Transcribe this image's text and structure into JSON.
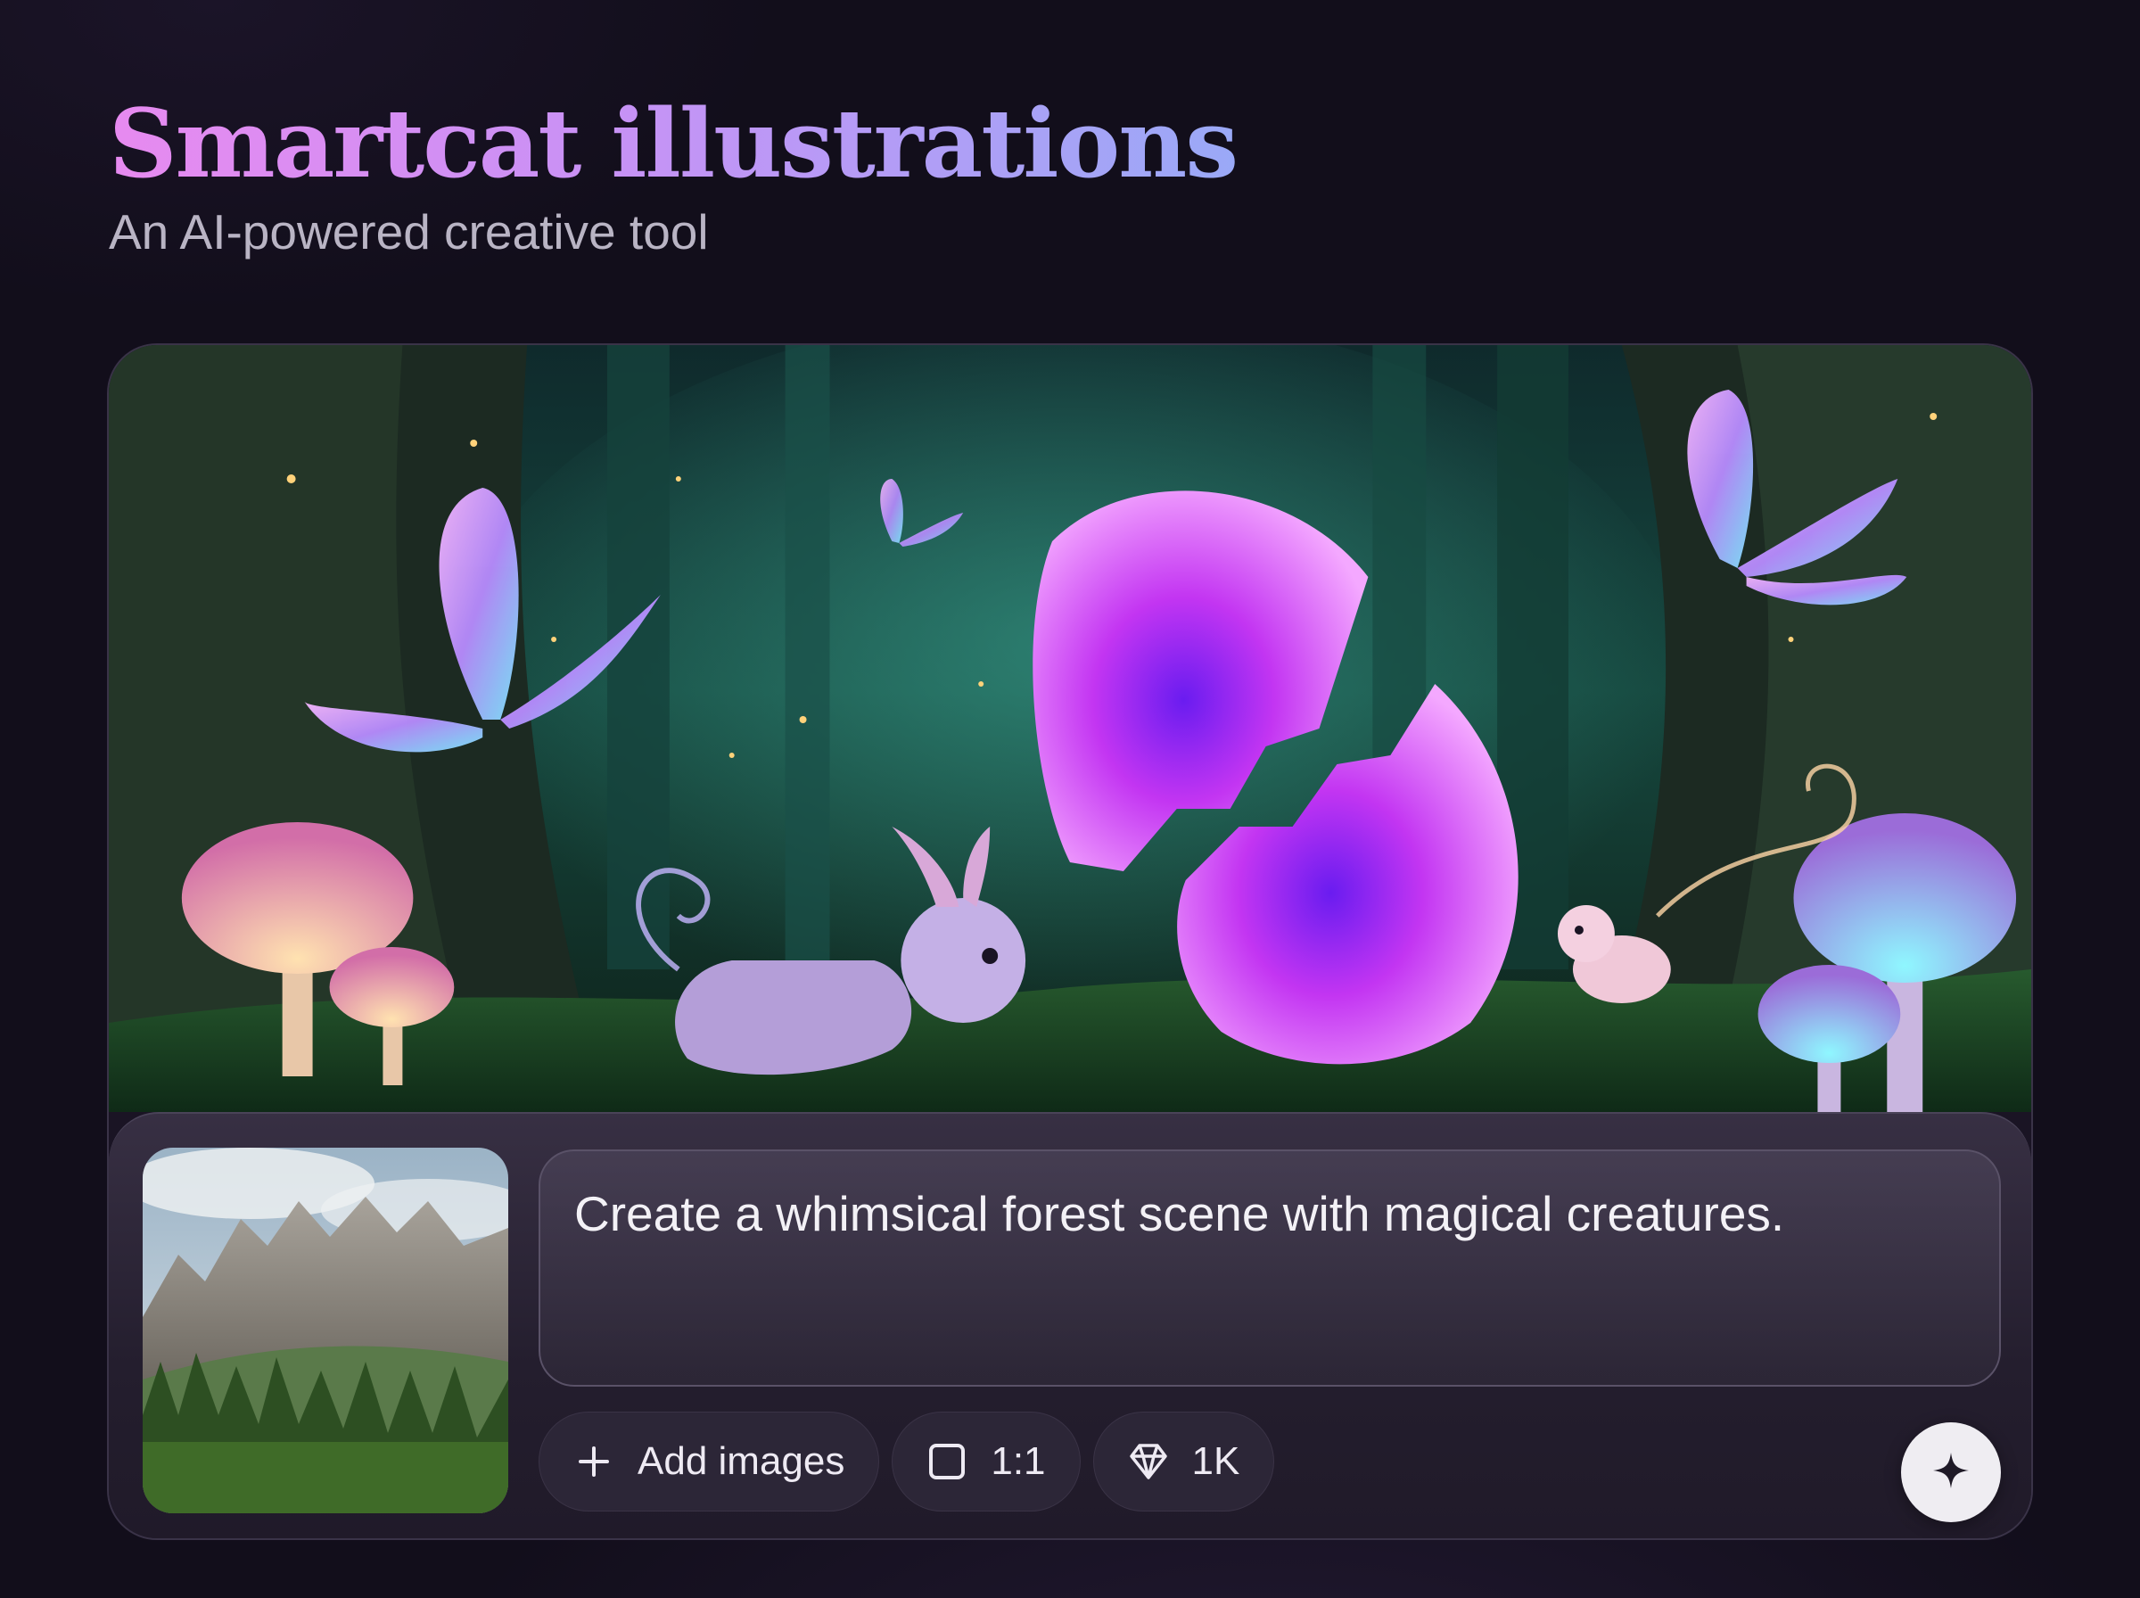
{
  "header": {
    "title": "Smartcat illustrations",
    "subtitle": "An AI-powered creative tool"
  },
  "hero": {
    "image": "whimsical-forest-illustration"
  },
  "composer": {
    "reference_image": "mountain-forest-thumbnail",
    "prompt": "Create a whimsical forest scene with magical creatures.",
    "add_images_label": "Add images",
    "aspect_ratio_label": "1:1",
    "resolution_label": "1K",
    "icons": {
      "add": "plus-icon",
      "aspect": "square-icon",
      "resolution": "diamond-icon",
      "generate": "sparkle-icon"
    }
  },
  "colors": {
    "background": "#120e1b",
    "title_gradient_start": "#e78af0",
    "title_gradient_end": "#9aa9f7",
    "chip_bg": "#2c2637",
    "send_button_bg": "#efedf2"
  }
}
